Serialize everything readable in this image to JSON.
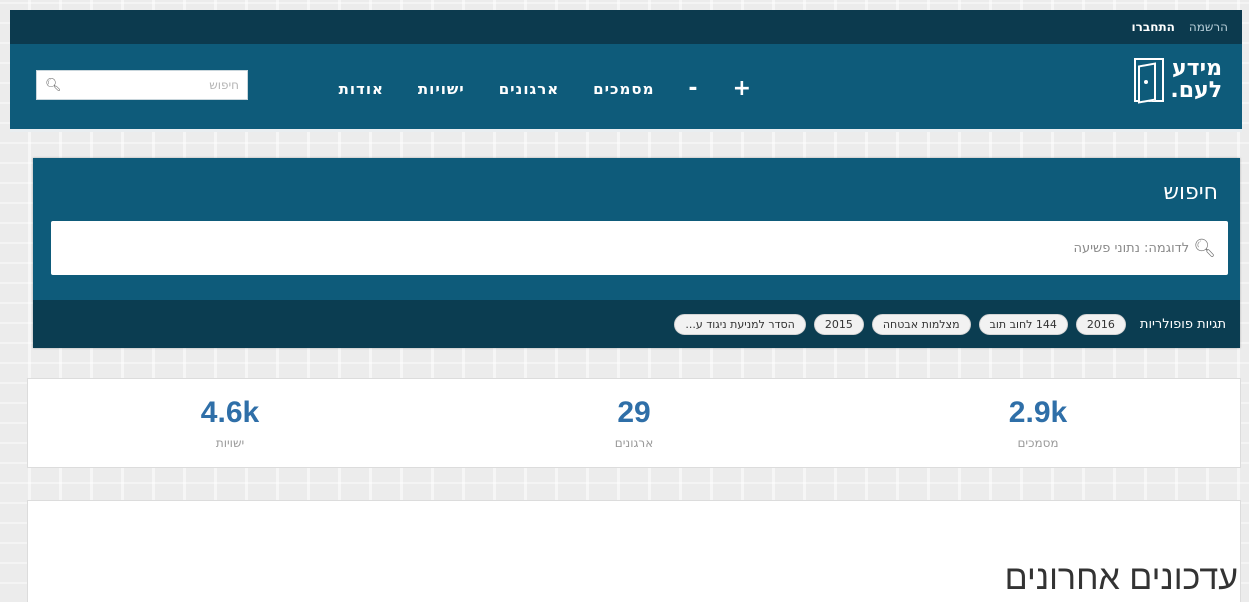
{
  "topbar": {
    "register": "הרשמה",
    "login": "התחברו"
  },
  "logo": {
    "line1": "מידע",
    "line2": "לעם."
  },
  "nav": {
    "plus": "+",
    "minus": "-",
    "documents": "מסמכים",
    "organizations": "ארגונים",
    "entities": "ישויות",
    "about": "אודות",
    "search_placeholder": "חיפוש"
  },
  "search_panel": {
    "title": "חיפוש",
    "placeholder": "לדוגמה: נתוני פשיעה",
    "tags_label": "תגיות פופולריות",
    "tags": [
      "2016",
      "144 לחוב תוב",
      "מצלמות אבטחה",
      "2015",
      "הסדר למניעת ניגוד ע..."
    ]
  },
  "stats": [
    {
      "value": "2.9k",
      "label": "מסמכים"
    },
    {
      "value": "29",
      "label": "ארגונים"
    },
    {
      "value": "4.6k",
      "label": "ישויות"
    }
  ],
  "updates": {
    "title": "עדכונים אחרונים"
  },
  "colors": {
    "topbar": "#0c3a4e",
    "navbar": "#0e5b7a",
    "tags_bar": "#0b3d51",
    "stat_number": "#2f6fa8"
  }
}
